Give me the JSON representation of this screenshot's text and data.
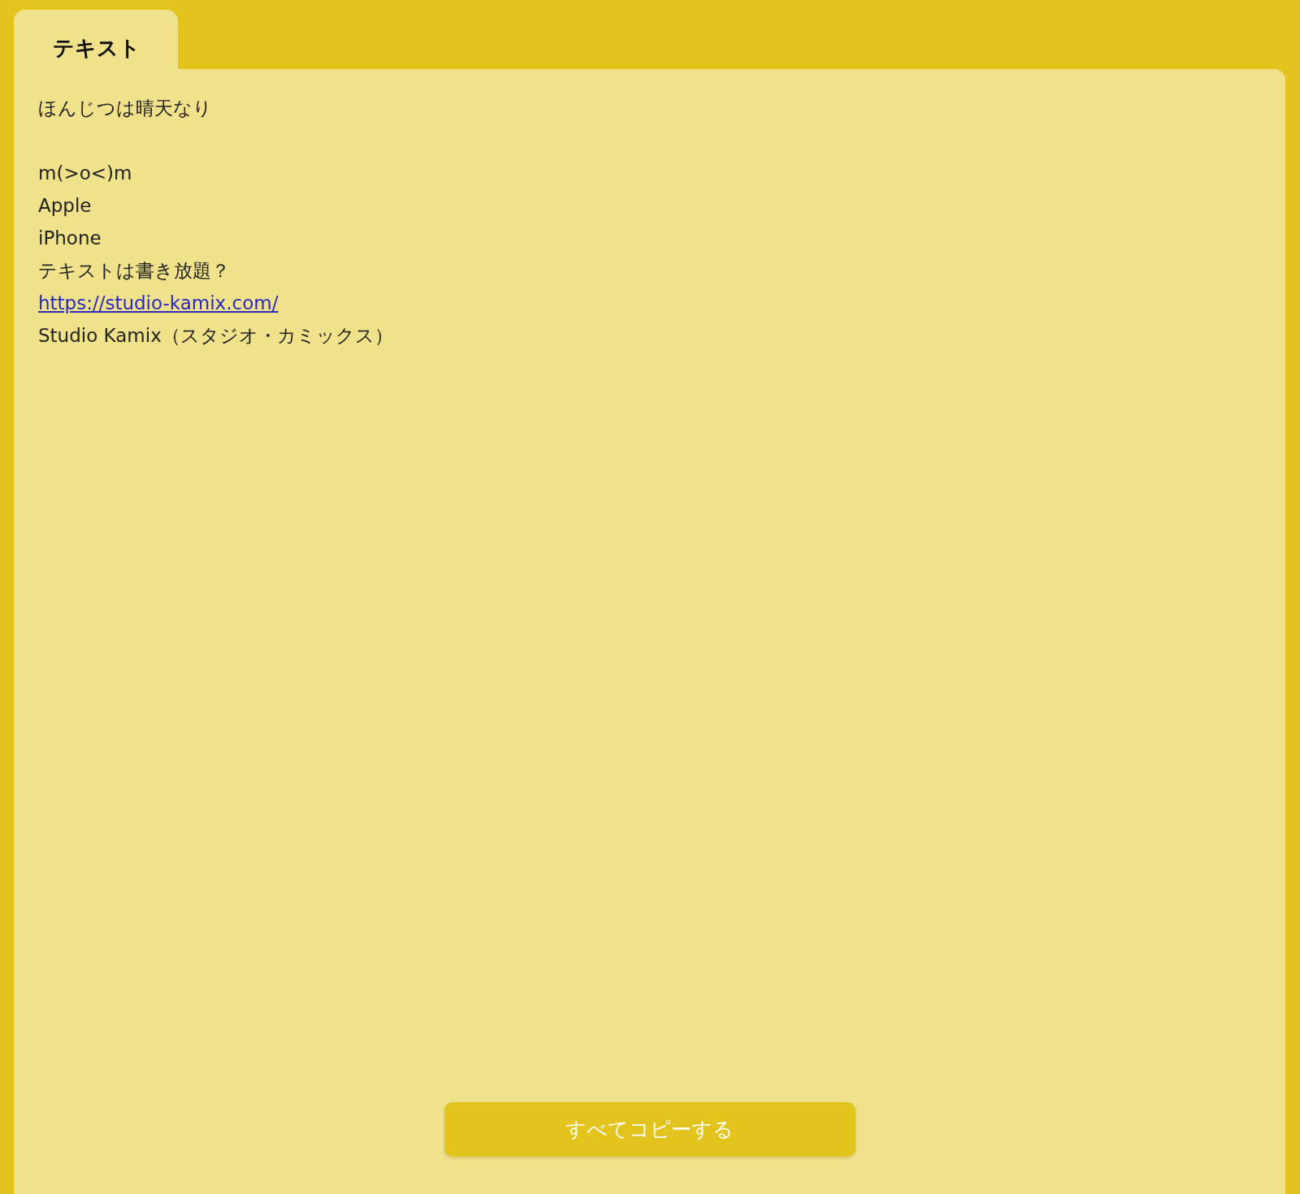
{
  "tabs": [
    {
      "label": "テキスト",
      "selected": true
    }
  ],
  "blocks": [
    {
      "lines": [
        {
          "kind": "text",
          "text": "ほんじつは晴天なり"
        }
      ]
    },
    {
      "lines": [
        {
          "kind": "text",
          "text": "m(>o<)m"
        },
        {
          "kind": "text",
          "text": "Apple"
        },
        {
          "kind": "text",
          "text": "iPhone"
        },
        {
          "kind": "text",
          "text": "テキストは書き放題？"
        },
        {
          "kind": "link",
          "text": "https://studio-kamix.com/"
        },
        {
          "kind": "text",
          "text": "Studio Kamix（スタジオ・カミックス）"
        }
      ]
    }
  ],
  "button": {
    "label": "すべてコピーする"
  }
}
